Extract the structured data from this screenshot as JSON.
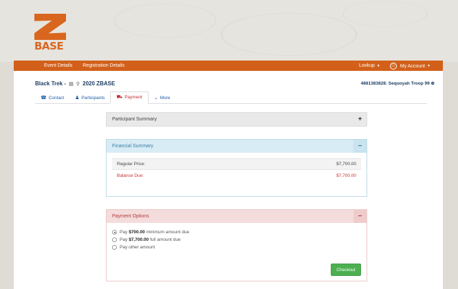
{
  "brand": {
    "logo_text": "BASE",
    "accent": "#d2601a"
  },
  "nav": {
    "event_details": "Event Details",
    "registration_details": "Registration Details",
    "lookup": "Lookup",
    "my_account": "My Account"
  },
  "header": {
    "title_prefix": "Black Trek -",
    "title_suffix": "2020 ZBASE",
    "account_ref": "4881383828: Sequoyah Troop 99"
  },
  "tabs": [
    {
      "label": "Contact",
      "icon": "contact-card-icon"
    },
    {
      "label": "Participants",
      "icon": "person-icon"
    },
    {
      "label": "Payment",
      "icon": "cart-icon"
    },
    {
      "label": "More",
      "icon": "chevron-down-icon"
    }
  ],
  "participant_summary": {
    "title": "Participant Summary",
    "toggle": "+"
  },
  "financial_summary": {
    "title": "Financial Summary",
    "toggle": "−",
    "rows": [
      {
        "label": "Regular Price:",
        "amount": "$7,700.00"
      },
      {
        "label": "Balance Due:",
        "amount": "$7,700.00"
      }
    ]
  },
  "payment_options": {
    "title": "Payment Options",
    "toggle": "−",
    "options": [
      {
        "pre": "Pay",
        "amount": "$700.00",
        "post": "minimum amount due",
        "checked": true
      },
      {
        "pre": "Pay",
        "amount": "$7,700.00",
        "post": "full amount due",
        "checked": false
      },
      {
        "pre": "Pay other amount",
        "amount": "",
        "post": "",
        "checked": false
      }
    ],
    "checkout_label": "Checkout"
  }
}
